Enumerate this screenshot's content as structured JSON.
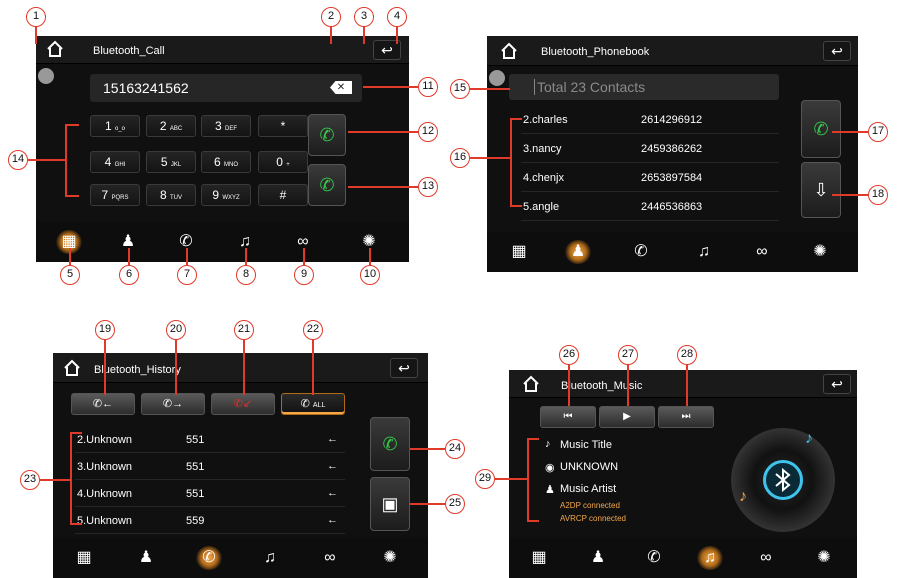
{
  "call": {
    "title": "Bluetooth_Call",
    "number": "15163241562",
    "keys": [
      {
        "d": "1",
        "s": "ᴏ_ᴏ"
      },
      {
        "d": "2",
        "s": "ABC"
      },
      {
        "d": "3",
        "s": "DEF"
      },
      {
        "d": "*",
        "s": ""
      },
      {
        "d": "4",
        "s": "GHI"
      },
      {
        "d": "5",
        "s": "JKL"
      },
      {
        "d": "6",
        "s": "MNO"
      },
      {
        "d": "0",
        "s": "+"
      },
      {
        "d": "7",
        "s": "PQRS"
      },
      {
        "d": "8",
        "s": "TUV"
      },
      {
        "d": "9",
        "s": "WXYZ"
      },
      {
        "d": "#",
        "s": ""
      }
    ]
  },
  "phonebook": {
    "title": "Bluetooth_Phonebook",
    "search_placeholder": "Total 23 Contacts",
    "contacts": [
      {
        "name": "2.charles",
        "number": "2614296912"
      },
      {
        "name": "3.nancy",
        "number": "2459386262"
      },
      {
        "name": "4.chenjx",
        "number": "2653897584"
      },
      {
        "name": "5.angle",
        "number": "2446536863"
      }
    ]
  },
  "history": {
    "title": "Bluetooth_History",
    "all_label": "ALL",
    "records": [
      {
        "name": "2.Unknown",
        "number": "551",
        "arrow": "←"
      },
      {
        "name": "3.Unknown",
        "number": "551",
        "arrow": "←"
      },
      {
        "name": "4.Unknown",
        "number": "551",
        "arrow": "←"
      },
      {
        "name": "5.Unknown",
        "number": "559",
        "arrow": "←"
      }
    ]
  },
  "music": {
    "title": "Bluetooth_Music",
    "track_title": "Music Title",
    "album": "UNKNOWN",
    "artist": "Music Artist",
    "status1": "A2DP connected",
    "status2": "AVRCP connected"
  },
  "callouts": [
    "1",
    "2",
    "3",
    "4",
    "5",
    "6",
    "7",
    "8",
    "9",
    "10",
    "11",
    "12",
    "13",
    "14",
    "15",
    "16",
    "17",
    "18",
    "19",
    "20",
    "21",
    "22",
    "23",
    "24",
    "25",
    "26",
    "27",
    "28",
    "29"
  ],
  "colors": {
    "accent": "#f4a84a",
    "callout": "#e03a2a",
    "green": "#35c94a",
    "red": "#e0302a"
  }
}
